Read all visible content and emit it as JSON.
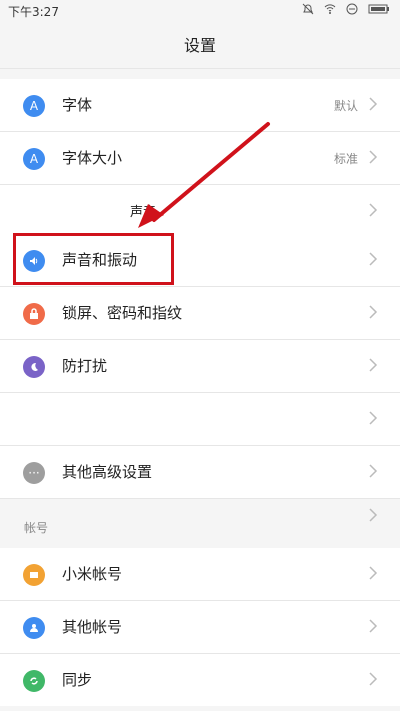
{
  "status_bar": {
    "time": "下午3:27"
  },
  "title": "设置",
  "rows": [
    {
      "label": "字体",
      "value": "默认",
      "icon": "font-icon",
      "color": "#3f8cf0"
    },
    {
      "label": "字体大小",
      "value": "标准",
      "icon": "font-size-icon",
      "color": "#3f8cf0"
    },
    {
      "label": "声音",
      "value": "",
      "icon": "",
      "color": ""
    },
    {
      "label": "声音和振动",
      "value": "",
      "icon": "sound-icon",
      "color": "#3f8cf0"
    },
    {
      "label": "锁屏、密码和指纹",
      "value": "",
      "icon": "lock-icon",
      "color": "#f06b49"
    },
    {
      "label": "防打扰",
      "value": "",
      "icon": "moon-icon",
      "color": "#7a63c7"
    },
    {
      "label": "",
      "value": "",
      "icon": "",
      "color": ""
    },
    {
      "label": "其他高级设置",
      "value": "",
      "icon": "more-icon",
      "color": "#9e9e9e"
    }
  ],
  "account_section": {
    "title": "帐号",
    "rows": [
      {
        "label": "小米帐号",
        "icon": "xiaomi-account-icon",
        "color": "#f2a233"
      },
      {
        "label": "其他帐号",
        "icon": "user-icon",
        "color": "#3f8cf0"
      },
      {
        "label": "同步",
        "icon": "sync-icon",
        "color": "#40b868"
      }
    ]
  }
}
